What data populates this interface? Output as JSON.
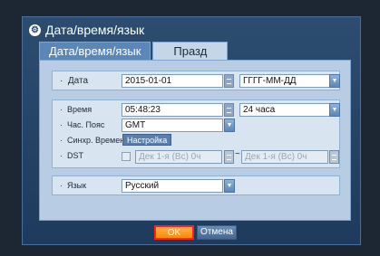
{
  "dialog": {
    "title": "Дата/время/язык",
    "tabs": [
      {
        "label": "Дата/время/язык"
      },
      {
        "label": "Празд"
      }
    ]
  },
  "date": {
    "label": "Дата",
    "value": "2015-01-01",
    "format": "ГГГГ-ММ-ДД"
  },
  "time": {
    "label": "Время",
    "value": "05:48:23",
    "format": "24 часа"
  },
  "timezone": {
    "label": "Час. Пояс",
    "value": "GMT"
  },
  "sync": {
    "label": "Синхр. Времени",
    "button": "Настройка"
  },
  "dst": {
    "label": "DST",
    "from": "Дек 1-я (Вс) 0ч",
    "to": "Дек 1-я (Вс) 0ч",
    "separator": "~"
  },
  "language": {
    "label": "Язык",
    "value": "Русский"
  },
  "buttons": {
    "ok": "OK",
    "cancel": "Отмена"
  }
}
